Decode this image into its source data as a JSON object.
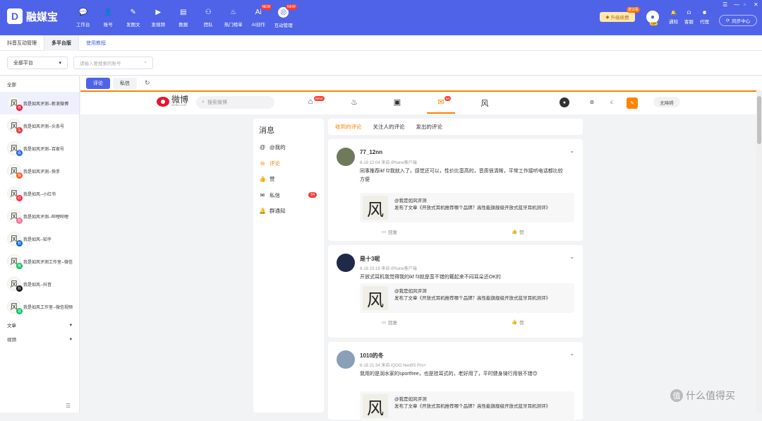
{
  "app": {
    "name": "融媒宝",
    "logo": "D"
  },
  "nav": [
    {
      "label": "工作台",
      "icon": "chat-icon",
      "glyph": "💬",
      "new": false,
      "active": false
    },
    {
      "label": "账号",
      "icon": "user-icon",
      "glyph": "👤",
      "new": false,
      "active": false
    },
    {
      "label": "发图文",
      "icon": "pen-icon",
      "glyph": "✎",
      "new": false,
      "active": false
    },
    {
      "label": "发视频",
      "icon": "play-icon",
      "glyph": "▶",
      "new": false,
      "active": false
    },
    {
      "label": "数据",
      "icon": "data-icon",
      "glyph": "▤",
      "new": false,
      "active": false
    },
    {
      "label": "团队",
      "icon": "team-icon",
      "glyph": "⚇",
      "new": false,
      "active": false
    },
    {
      "label": "热门榜单",
      "icon": "fire-icon",
      "glyph": "♨",
      "new": false,
      "active": false
    },
    {
      "label": "AI创作",
      "icon": "ai-icon",
      "glyph": "Ai",
      "new": true,
      "active": false
    },
    {
      "label": "互动管理",
      "icon": "interact-icon",
      "glyph": "◎",
      "new": true,
      "active": true
    }
  ],
  "new_badge": "NEW",
  "topright": {
    "upgrade": "升级续费",
    "upgrade_tag": "建议看",
    "vip": "VIP",
    "tools": [
      {
        "label": "通知",
        "icon": "bell-icon",
        "glyph": "🔔"
      },
      {
        "label": "客服",
        "icon": "support-icon",
        "glyph": "☊"
      },
      {
        "label": "代理",
        "icon": "agent-icon",
        "glyph": "⚉"
      }
    ],
    "sync": "同步中心"
  },
  "tabs": [
    {
      "label": "抖音互动管理",
      "active": false,
      "link": false
    },
    {
      "label": "多平台版",
      "active": true,
      "link": false
    },
    {
      "label": "使用教程",
      "active": false,
      "link": true
    }
  ],
  "filter": {
    "platform": "全部平台",
    "search_placeholder": "请输入要搜索的账号"
  },
  "sidebar": {
    "head": "全部",
    "accounts": [
      {
        "label": "我是如风评测--新浪微博",
        "plat": "微",
        "plat_color": "#e6162d",
        "active": true
      },
      {
        "label": "我是如风评测--头条号",
        "plat": "头",
        "plat_color": "#e83a3a",
        "active": false
      },
      {
        "label": "我是如风评测--百家号",
        "plat": "百",
        "plat_color": "#2b63f0",
        "active": false
      },
      {
        "label": "我是如风评测--快手",
        "plat": "快",
        "plat_color": "#ff5a1f",
        "active": false
      },
      {
        "label": "我是如风--小红书",
        "plat": "红",
        "plat_color": "#ff2442",
        "active": false
      },
      {
        "label": "我是如风评测--哔哩哔哩",
        "plat": "B",
        "plat_color": "#fb7299",
        "active": false
      },
      {
        "label": "我是如风--知乎",
        "plat": "知",
        "plat_color": "#0a66c2",
        "active": false
      },
      {
        "label": "我是如风评测工作室--微信",
        "plat": "微",
        "plat_color": "#07c160",
        "active": false
      },
      {
        "label": "我是如风--抖音",
        "plat": "抖",
        "plat_color": "#111111",
        "active": false
      },
      {
        "label": "我是如风工作室--微信视频",
        "plat": "视",
        "plat_color": "#07c160",
        "active": false
      }
    ],
    "groups": [
      "文章",
      "视频"
    ]
  },
  "subtabs": {
    "comment": "评论",
    "dm": "私信"
  },
  "weibo": {
    "name": "微博",
    "domain": "weibo.com",
    "search_placeholder": "搜索微博",
    "nav_new": "NEW",
    "msg_count": "54",
    "access": "无障碍",
    "panel_title": "消息",
    "menu": [
      {
        "label": "@我的",
        "glyph": "@",
        "icon": "at-icon",
        "active": false
      },
      {
        "label": "评论",
        "glyph": "⊖",
        "icon": "comment-icon",
        "active": true
      },
      {
        "label": "赞",
        "glyph": "👍",
        "icon": "like-icon",
        "active": false
      },
      {
        "label": "私信",
        "glyph": "✉",
        "icon": "mail-icon",
        "active": false,
        "badge": "54"
      },
      {
        "label": "群通知",
        "glyph": "🔔",
        "icon": "bell-icon",
        "active": false
      }
    ],
    "feed_tabs": [
      "收到的评论",
      "关注人的评论",
      "发出的评论"
    ]
  },
  "cards": [
    {
      "name": "77_12nn",
      "meta": "6-19 22:04 来自 iPhone客户端",
      "text": "同事推荐ikf f2我就入了，感觉还可以，性价比蛮高的，音质很清晰，平常工作接听电话都比较方便",
      "quote_user": "@我是如风评测",
      "quote_text": "发布了文章《开放式耳机推荐哪个品牌？高性能旗舰级开放式蓝牙耳机测评》",
      "reply": "回复",
      "like": "赞",
      "av_color": "#6e7a5a"
    },
    {
      "name": "是十3呢",
      "meta": "6-18 23:19 来自 iPhone客户端",
      "text": "开放式耳机我觉得我的ikf f3就是蛮不错的戴起来不闷耳朵还OK的",
      "quote_user": "@我是如风评测",
      "quote_text": "发布了文章《开放式耳机推荐哪个品牌？高性能旗舰级开放式蓝牙耳机测评》",
      "reply": "回复",
      "like": "赞",
      "av_color": "#1f2a4a"
    },
    {
      "name": "1010的冬",
      "meta": "6-18 21:34 来自 iQOO Neo9S Pro+",
      "text": "我用的是润水家的sportfree，也是挂耳式的，老好用了，平时健身骑行用很不错😊",
      "quote_user": "@我是如风评测",
      "quote_text": "发布了文章《开放式耳机推荐哪个品牌？高性能旗舰级开放式蓝牙耳机测评》",
      "reply": "回复",
      "like": "赞",
      "av_color": "#8aa0b8"
    }
  ],
  "quote_char": "风",
  "watermark": "什么值得买"
}
